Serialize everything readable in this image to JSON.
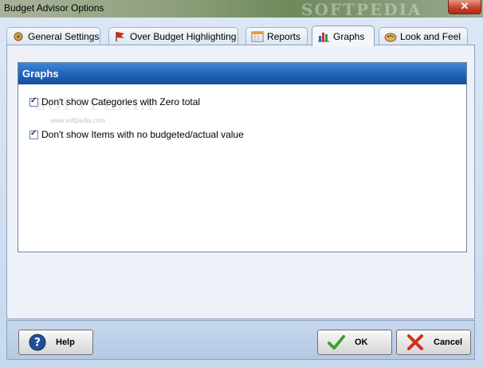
{
  "window": {
    "title": "Budget Advisor Options",
    "watermark": "SOFTPEDIA",
    "close_glyph": "✕"
  },
  "tabs": [
    {
      "label": "General Settings",
      "icon": "settings-gear-icon",
      "active": false
    },
    {
      "label": "Over Budget Highlighting",
      "icon": "flag-icon",
      "active": false
    },
    {
      "label": "Reports",
      "icon": "calendar-grid-icon",
      "active": false
    },
    {
      "label": "Graphs",
      "icon": "bar-chart-icon",
      "active": true
    },
    {
      "label": "Look and Feel",
      "icon": "palette-icon",
      "active": false
    }
  ],
  "graphs": {
    "header": "Graphs",
    "options": [
      {
        "label": "Don't show Categories with Zero total",
        "checked": true
      },
      {
        "label": "Don't show Items with no budgeted/actual value",
        "checked": true
      }
    ],
    "watermark": "SOFTPEDIA",
    "watermark_url": "www.softpedia.com"
  },
  "buttons": {
    "help": "Help",
    "ok": "OK",
    "cancel": "Cancel"
  },
  "colors": {
    "header_blue": "#1d5fb3",
    "ok_green": "#3aa02a",
    "cancel_red": "#d0301c",
    "help_blue": "#1d4f9a"
  }
}
